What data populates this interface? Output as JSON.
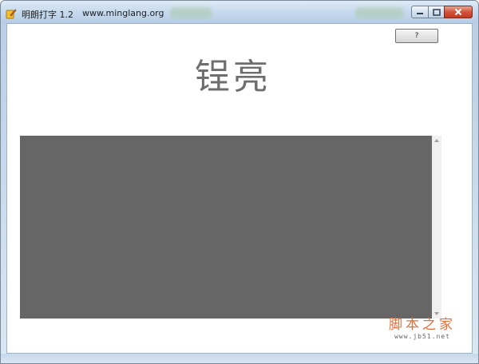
{
  "window": {
    "title": "明朗打字 1.2",
    "url_text": "www.minglang.org",
    "app_icon": "pencil-icon",
    "controls": {
      "minimize_icon": "minimize-icon",
      "maximize_icon": "maximize-icon",
      "close_icon": "close-icon"
    }
  },
  "toolbar": {
    "help_label": "?"
  },
  "main": {
    "current_word": "锃亮"
  },
  "typing_area": {
    "value": "",
    "background": "#666666"
  },
  "watermark": {
    "main": "脚本之家",
    "sub": "www.jb51.net"
  },
  "colors": {
    "accent": "#e0703a",
    "titlebar": "#c6daee",
    "close": "#c43a1f"
  }
}
